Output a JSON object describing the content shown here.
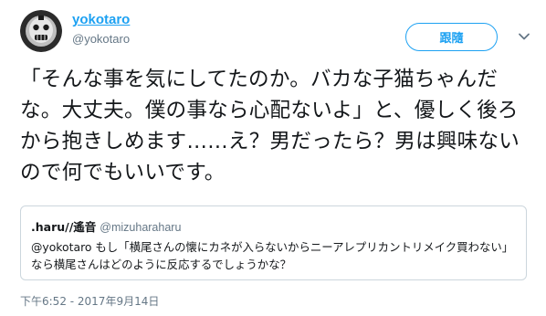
{
  "author": {
    "display_name": "yokotaro",
    "screen_name": "@yokotaro",
    "avatar_icon": "masked-face-avatar-icon"
  },
  "actions": {
    "follow_label": "跟隨",
    "more_icon": "chevron-down-icon"
  },
  "tweet": {
    "text": "「そんな事を気にしてたのか。バカな子猫ちゃんだな。大丈夫。僕の事なら心配ないよ」と、優しく後ろから抱きしめます……え？男だったら？男は興味ないので何でもいいです。",
    "timestamp": "下午6:52 - 2017年9月14日"
  },
  "quoted_tweet": {
    "display_name": ".haru//遙音",
    "screen_name": "@mizuharaharu",
    "text": "@yokotaro もし「横尾さんの懐にカネが入らないからニーアレプリカントリメイク買わない」なら横尾さんはどのように反応するでしょうかな？"
  },
  "colors": {
    "accent": "#1da1f2",
    "text": "#14171a",
    "secondary": "#657786",
    "border": "#ccd6dd"
  }
}
